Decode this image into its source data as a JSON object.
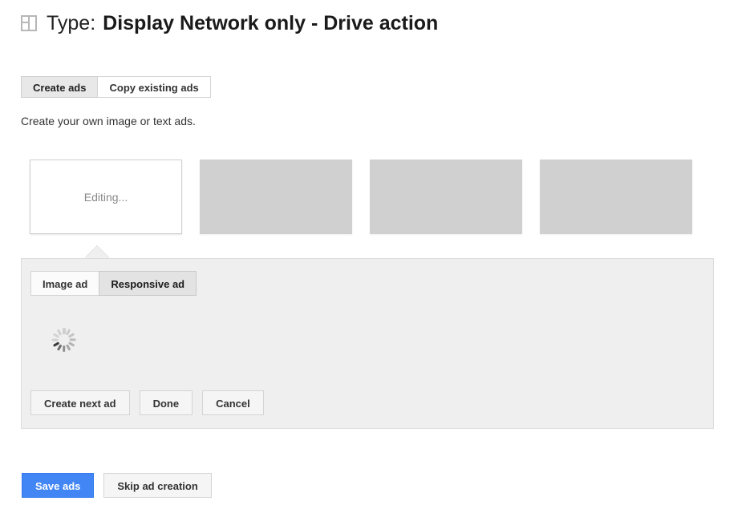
{
  "header": {
    "icon": "layout-grid-icon",
    "label": "Type:",
    "title": "Display Network only - Drive action"
  },
  "tabs": [
    {
      "label": "Create ads",
      "selected": true
    },
    {
      "label": "Copy existing ads",
      "selected": false
    }
  ],
  "subtitle": "Create your own image or text ads.",
  "thumbnails": [
    {
      "state": "editing",
      "label": "Editing..."
    },
    {
      "state": "placeholder",
      "label": ""
    },
    {
      "state": "placeholder",
      "label": ""
    },
    {
      "state": "placeholder",
      "label": ""
    }
  ],
  "editor": {
    "tabs": [
      {
        "label": "Image ad",
        "selected": false
      },
      {
        "label": "Responsive ad",
        "selected": true
      }
    ],
    "loading_indicator": "loading-spinner-icon",
    "actions": [
      {
        "label": "Create next ad"
      },
      {
        "label": "Done"
      },
      {
        "label": "Cancel"
      }
    ]
  },
  "footer": {
    "primary": "Save ads",
    "secondary": "Skip ad creation"
  },
  "colors": {
    "primary_button": "#4285f4",
    "panel_background": "#efefef",
    "placeholder_thumb": "#d0d0d0"
  }
}
